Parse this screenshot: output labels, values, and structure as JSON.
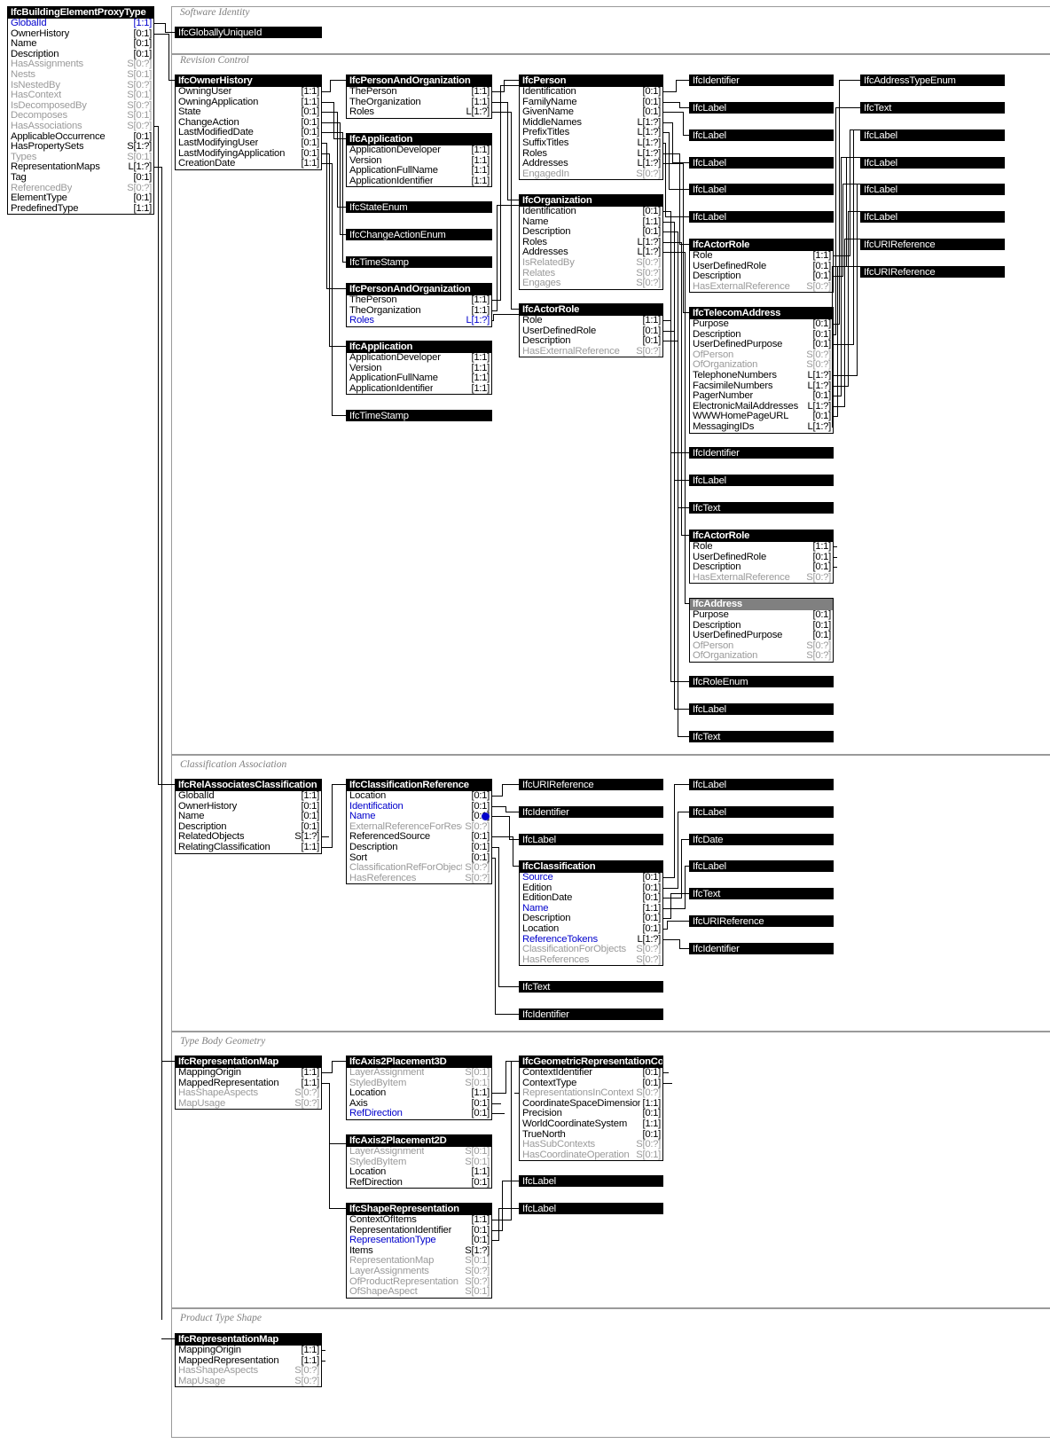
{
  "diagram": {
    "title": "IfcBuildingElementProxyType",
    "kind": "ifc-express-schema-diagram",
    "colors": {
      "entity_header_bg": "#000000",
      "abstract_header_bg": "#808080",
      "inverse_attr": "#9a9a9a",
      "key_attr": "#0000cc",
      "section_border": "#9a9a9a"
    }
  },
  "sections": [
    {
      "id": "software-identity",
      "label": "Software Identity"
    },
    {
      "id": "revision-control",
      "label": "Revision Control"
    },
    {
      "id": "classification-association",
      "label": "Classification Association"
    },
    {
      "id": "type-body-geometry",
      "label": "Type Body Geometry"
    },
    {
      "id": "product-type-shape",
      "label": "Product Type Shape"
    }
  ],
  "entities": {
    "root": {
      "name": "IfcBuildingElementProxyType",
      "attrs": [
        {
          "attr": "GlobalId",
          "card": "[1:1]",
          "style": "key"
        },
        {
          "attr": "OwnerHistory",
          "card": "[0:1]",
          "style": ""
        },
        {
          "attr": "Name",
          "card": "[0:1]",
          "style": ""
        },
        {
          "attr": "Description",
          "card": "[0:1]",
          "style": ""
        },
        {
          "attr": "HasAssignments",
          "card": "S[0:?]",
          "style": "inv"
        },
        {
          "attr": "Nests",
          "card": "S[0:1]",
          "style": "inv"
        },
        {
          "attr": "IsNestedBy",
          "card": "S[0:?]",
          "style": "inv"
        },
        {
          "attr": "HasContext",
          "card": "S[0:1]",
          "style": "inv"
        },
        {
          "attr": "IsDecomposedBy",
          "card": "S[0:?]",
          "style": "inv"
        },
        {
          "attr": "Decomposes",
          "card": "S[0:1]",
          "style": "inv"
        },
        {
          "attr": "HasAssociations",
          "card": "S[0:?]",
          "style": "inv"
        },
        {
          "attr": "ApplicableOccurrence",
          "card": "[0:1]",
          "style": ""
        },
        {
          "attr": "HasPropertySets",
          "card": "S[1:?]",
          "style": ""
        },
        {
          "attr": "Types",
          "card": "S[0:1]",
          "style": "inv"
        },
        {
          "attr": "RepresentationMaps",
          "card": "L[1:?]",
          "style": ""
        },
        {
          "attr": "Tag",
          "card": "[0:1]",
          "style": ""
        },
        {
          "attr": "ReferencedBy",
          "card": "S[0:?]",
          "style": "inv"
        },
        {
          "attr": "ElementType",
          "card": "[0:1]",
          "style": ""
        },
        {
          "attr": "PredefinedType",
          "card": "[1:1]",
          "style": ""
        }
      ]
    },
    "owner_history": {
      "name": "IfcOwnerHistory",
      "attrs": [
        {
          "attr": "OwningUser",
          "card": "[1:1]",
          "style": ""
        },
        {
          "attr": "OwningApplication",
          "card": "[1:1]",
          "style": ""
        },
        {
          "attr": "State",
          "card": "[0:1]",
          "style": ""
        },
        {
          "attr": "ChangeAction",
          "card": "[0:1]",
          "style": ""
        },
        {
          "attr": "LastModifiedDate",
          "card": "[0:1]",
          "style": ""
        },
        {
          "attr": "LastModifyingUser",
          "card": "[0:1]",
          "style": ""
        },
        {
          "attr": "LastModifyingApplication",
          "card": "[0:1]",
          "style": ""
        },
        {
          "attr": "CreationDate",
          "card": "[1:1]",
          "style": ""
        }
      ]
    },
    "person_and_org_1": {
      "name": "IfcPersonAndOrganization",
      "attrs": [
        {
          "attr": "ThePerson",
          "card": "[1:1]",
          "style": ""
        },
        {
          "attr": "TheOrganization",
          "card": "[1:1]",
          "style": ""
        },
        {
          "attr": "Roles",
          "card": "L[1:?]",
          "style": ""
        }
      ]
    },
    "application_1": {
      "name": "IfcApplication",
      "attrs": [
        {
          "attr": "ApplicationDeveloper",
          "card": "[1:1]",
          "style": ""
        },
        {
          "attr": "Version",
          "card": "[1:1]",
          "style": ""
        },
        {
          "attr": "ApplicationFullName",
          "card": "[1:1]",
          "style": ""
        },
        {
          "attr": "ApplicationIdentifier",
          "card": "[1:1]",
          "style": ""
        }
      ]
    },
    "person_and_org_2": {
      "name": "IfcPersonAndOrganization",
      "attrs": [
        {
          "attr": "ThePerson",
          "card": "[1:1]",
          "style": ""
        },
        {
          "attr": "TheOrganization",
          "card": "[1:1]",
          "style": ""
        },
        {
          "attr": "Roles",
          "card": "L[1:?]",
          "style": "key"
        }
      ]
    },
    "application_2": {
      "name": "IfcApplication",
      "attrs": [
        {
          "attr": "ApplicationDeveloper",
          "card": "[1:1]",
          "style": ""
        },
        {
          "attr": "Version",
          "card": "[1:1]",
          "style": ""
        },
        {
          "attr": "ApplicationFullName",
          "card": "[1:1]",
          "style": ""
        },
        {
          "attr": "ApplicationIdentifier",
          "card": "[1:1]",
          "style": ""
        }
      ]
    },
    "person": {
      "name": "IfcPerson",
      "attrs": [
        {
          "attr": "Identification",
          "card": "[0:1]",
          "style": ""
        },
        {
          "attr": "FamilyName",
          "card": "[0:1]",
          "style": ""
        },
        {
          "attr": "GivenName",
          "card": "[0:1]",
          "style": ""
        },
        {
          "attr": "MiddleNames",
          "card": "L[1:?]",
          "style": ""
        },
        {
          "attr": "PrefixTitles",
          "card": "L[1:?]",
          "style": ""
        },
        {
          "attr": "SuffixTitles",
          "card": "L[1:?]",
          "style": ""
        },
        {
          "attr": "Roles",
          "card": "L[1:?]",
          "style": ""
        },
        {
          "attr": "Addresses",
          "card": "L[1:?]",
          "style": ""
        },
        {
          "attr": "EngagedIn",
          "card": "S[0:?]",
          "style": "inv"
        }
      ]
    },
    "organization": {
      "name": "IfcOrganization",
      "attrs": [
        {
          "attr": "Identification",
          "card": "[0:1]",
          "style": ""
        },
        {
          "attr": "Name",
          "card": "[1:1]",
          "style": ""
        },
        {
          "attr": "Description",
          "card": "[0:1]",
          "style": ""
        },
        {
          "attr": "Roles",
          "card": "L[1:?]",
          "style": ""
        },
        {
          "attr": "Addresses",
          "card": "L[1:?]",
          "style": ""
        },
        {
          "attr": "IsRelatedBy",
          "card": "S[0:?]",
          "style": "inv"
        },
        {
          "attr": "Relates",
          "card": "S[0:?]",
          "style": "inv"
        },
        {
          "attr": "Engages",
          "card": "S[0:?]",
          "style": "inv"
        }
      ]
    },
    "actor_role_mid": {
      "name": "IfcActorRole",
      "attrs": [
        {
          "attr": "Role",
          "card": "[1:1]",
          "style": ""
        },
        {
          "attr": "UserDefinedRole",
          "card": "[0:1]",
          "style": ""
        },
        {
          "attr": "Description",
          "card": "[0:1]",
          "style": ""
        },
        {
          "attr": "HasExternalReference",
          "card": "S[0:?]",
          "style": "inv"
        }
      ]
    },
    "actor_role_r1": {
      "name": "IfcActorRole",
      "attrs": [
        {
          "attr": "Role",
          "card": "[1:1]",
          "style": ""
        },
        {
          "attr": "UserDefinedRole",
          "card": "[0:1]",
          "style": ""
        },
        {
          "attr": "Description",
          "card": "[0:1]",
          "style": ""
        },
        {
          "attr": "HasExternalReference",
          "card": "S[0:?]",
          "style": "inv"
        }
      ]
    },
    "actor_role_r2": {
      "name": "IfcActorRole",
      "attrs": [
        {
          "attr": "Role",
          "card": "[1:1]",
          "style": ""
        },
        {
          "attr": "UserDefinedRole",
          "card": "[0:1]",
          "style": ""
        },
        {
          "attr": "Description",
          "card": "[0:1]",
          "style": ""
        },
        {
          "attr": "HasExternalReference",
          "card": "S[0:?]",
          "style": "inv"
        }
      ]
    },
    "telecom_address": {
      "name": "IfcTelecomAddress",
      "attrs": [
        {
          "attr": "Purpose",
          "card": "[0:1]",
          "style": ""
        },
        {
          "attr": "Description",
          "card": "[0:1]",
          "style": ""
        },
        {
          "attr": "UserDefinedPurpose",
          "card": "[0:1]",
          "style": ""
        },
        {
          "attr": "OfPerson",
          "card": "S[0:?]",
          "style": "inv"
        },
        {
          "attr": "OfOrganization",
          "card": "S[0:?]",
          "style": "inv"
        },
        {
          "attr": "TelephoneNumbers",
          "card": "L[1:?]",
          "style": ""
        },
        {
          "attr": "FacsimileNumbers",
          "card": "L[1:?]",
          "style": ""
        },
        {
          "attr": "PagerNumber",
          "card": "[0:1]",
          "style": ""
        },
        {
          "attr": "ElectronicMailAddresses",
          "card": "L[1:?]",
          "style": ""
        },
        {
          "attr": "WWWHomePageURL",
          "card": "[0:1]",
          "style": ""
        },
        {
          "attr": "MessagingIDs",
          "card": "L[1:?]",
          "style": ""
        }
      ]
    },
    "address": {
      "name": "IfcAddress",
      "abstract": true,
      "attrs": [
        {
          "attr": "Purpose",
          "card": "[0:1]",
          "style": ""
        },
        {
          "attr": "Description",
          "card": "[0:1]",
          "style": ""
        },
        {
          "attr": "UserDefinedPurpose",
          "card": "[0:1]",
          "style": ""
        },
        {
          "attr": "OfPerson",
          "card": "S[0:?]",
          "style": "inv"
        },
        {
          "attr": "OfOrganization",
          "card": "S[0:?]",
          "style": "inv"
        }
      ]
    },
    "rel_associates_classification": {
      "name": "IfcRelAssociatesClassification",
      "attrs": [
        {
          "attr": "GlobalId",
          "card": "[1:1]",
          "style": ""
        },
        {
          "attr": "OwnerHistory",
          "card": "[0:1]",
          "style": ""
        },
        {
          "attr": "Name",
          "card": "[0:1]",
          "style": ""
        },
        {
          "attr": "Description",
          "card": "[0:1]",
          "style": ""
        },
        {
          "attr": "RelatedObjects",
          "card": "S[1:?]",
          "style": ""
        },
        {
          "attr": "RelatingClassification",
          "card": "[1:1]",
          "style": ""
        }
      ]
    },
    "classification_reference": {
      "name": "IfcClassificationReference",
      "attrs": [
        {
          "attr": "Location",
          "card": "[0:1]",
          "style": ""
        },
        {
          "attr": "Identification",
          "card": "[0:1]",
          "style": "keyname"
        },
        {
          "attr": "Name",
          "card": "[0:1]",
          "style": "keyname",
          "dot": true
        },
        {
          "attr": "ExternalReferenceForResources",
          "card": "S[0:?]",
          "style": "inv"
        },
        {
          "attr": "ReferencedSource",
          "card": "[0:1]",
          "style": ""
        },
        {
          "attr": "Description",
          "card": "[0:1]",
          "style": ""
        },
        {
          "attr": "Sort",
          "card": "[0:1]",
          "style": ""
        },
        {
          "attr": "ClassificationRefForObjects",
          "card": "S[0:?]",
          "style": "inv"
        },
        {
          "attr": "HasReferences",
          "card": "S[0:?]",
          "style": "inv"
        }
      ]
    },
    "classification": {
      "name": "IfcClassification",
      "attrs": [
        {
          "attr": "Source",
          "card": "[0:1]",
          "style": "keyname"
        },
        {
          "attr": "Edition",
          "card": "[0:1]",
          "style": ""
        },
        {
          "attr": "EditionDate",
          "card": "[0:1]",
          "style": ""
        },
        {
          "attr": "Name",
          "card": "[1:1]",
          "style": "keyname"
        },
        {
          "attr": "Description",
          "card": "[0:1]",
          "style": ""
        },
        {
          "attr": "Location",
          "card": "[0:1]",
          "style": ""
        },
        {
          "attr": "ReferenceTokens",
          "card": "L[1:?]",
          "style": "keyname"
        },
        {
          "attr": "ClassificationForObjects",
          "card": "S[0:?]",
          "style": "inv"
        },
        {
          "attr": "HasReferences",
          "card": "S[0:?]",
          "style": "inv"
        }
      ]
    },
    "representation_map_body": {
      "name": "IfcRepresentationMap",
      "attrs": [
        {
          "attr": "MappingOrigin",
          "card": "[1:1]",
          "style": ""
        },
        {
          "attr": "MappedRepresentation",
          "card": "[1:1]",
          "style": ""
        },
        {
          "attr": "HasShapeAspects",
          "card": "S[0:?]",
          "style": "inv"
        },
        {
          "attr": "MapUsage",
          "card": "S[0:?]",
          "style": "inv"
        }
      ]
    },
    "axis2placement3d": {
      "name": "IfcAxis2Placement3D",
      "attrs": [
        {
          "attr": "LayerAssignment",
          "card": "S[0:1]",
          "style": "inv"
        },
        {
          "attr": "StyledByItem",
          "card": "S[0:1]",
          "style": "inv"
        },
        {
          "attr": "Location",
          "card": "[1:1]",
          "style": ""
        },
        {
          "attr": "Axis",
          "card": "[0:1]",
          "style": ""
        },
        {
          "attr": "RefDirection",
          "card": "[0:1]",
          "style": "keyname"
        }
      ]
    },
    "axis2placement2d": {
      "name": "IfcAxis2Placement2D",
      "attrs": [
        {
          "attr": "LayerAssignment",
          "card": "S[0:1]",
          "style": "inv"
        },
        {
          "attr": "StyledByItem",
          "card": "S[0:1]",
          "style": "inv"
        },
        {
          "attr": "Location",
          "card": "[1:1]",
          "style": ""
        },
        {
          "attr": "RefDirection",
          "card": "[0:1]",
          "style": ""
        }
      ]
    },
    "shape_representation": {
      "name": "IfcShapeRepresentation",
      "attrs": [
        {
          "attr": "ContextOfItems",
          "card": "[1:1]",
          "style": ""
        },
        {
          "attr": "RepresentationIdentifier",
          "card": "[0:1]",
          "style": ""
        },
        {
          "attr": "RepresentationType",
          "card": "[0:1]",
          "style": "keyname"
        },
        {
          "attr": "Items",
          "card": "S[1:?]",
          "style": ""
        },
        {
          "attr": "RepresentationMap",
          "card": "S[0:1]",
          "style": "inv"
        },
        {
          "attr": "LayerAssignments",
          "card": "S[0:?]",
          "style": "inv"
        },
        {
          "attr": "OfProductRepresentation",
          "card": "S[0:?]",
          "style": "inv"
        },
        {
          "attr": "OfShapeAspect",
          "card": "S[0:1]",
          "style": "inv"
        }
      ]
    },
    "geometric_representation_context": {
      "name": "IfcGeometricRepresentationContext",
      "attrs": [
        {
          "attr": "ContextIdentifier",
          "card": "[0:1]",
          "style": ""
        },
        {
          "attr": "ContextType",
          "card": "[0:1]",
          "style": ""
        },
        {
          "attr": "RepresentationsInContext",
          "card": "S[0:?]",
          "style": "inv"
        },
        {
          "attr": "CoordinateSpaceDimension",
          "card": "[1:1]",
          "style": ""
        },
        {
          "attr": "Precision",
          "card": "[0:1]",
          "style": ""
        },
        {
          "attr": "WorldCoordinateSystem",
          "card": "[1:1]",
          "style": ""
        },
        {
          "attr": "TrueNorth",
          "card": "[0:1]",
          "style": ""
        },
        {
          "attr": "HasSubContexts",
          "card": "S[0:?]",
          "style": "inv"
        },
        {
          "attr": "HasCoordinateOperation",
          "card": "S[0:1]",
          "style": "inv"
        }
      ]
    },
    "representation_map_shape": {
      "name": "IfcRepresentationMap",
      "attrs": [
        {
          "attr": "MappingOrigin",
          "card": "[1:1]",
          "style": ""
        },
        {
          "attr": "MappedRepresentation",
          "card": "[1:1]",
          "style": ""
        },
        {
          "attr": "HasShapeAspects",
          "card": "S[0:?]",
          "style": "inv"
        },
        {
          "attr": "MapUsage",
          "card": "S[0:?]",
          "style": "inv"
        }
      ]
    }
  },
  "simple_types": {
    "globally_unique_id": "IfcGloballyUniqueId",
    "state_enum": "IfcStateEnum",
    "change_action_enum": "IfcChangeActionEnum",
    "timestamp_1": "IfcTimeStamp",
    "timestamp_2": "IfcTimeStamp",
    "col4_identifier_1": "IfcIdentifier",
    "col4_label_1": "IfcLabel",
    "col4_label_2": "IfcLabel",
    "col4_label_3": "IfcLabel",
    "col4_label_4": "IfcLabel",
    "col4_label_5": "IfcLabel",
    "col4_identifier_2": "IfcIdentifier",
    "col4_label_6": "IfcLabel",
    "col4_text_1": "IfcText",
    "col4_role_enum": "IfcRoleEnum",
    "col4_label_7": "IfcLabel",
    "col4_text_2": "IfcText",
    "col5_address_type_enum": "IfcAddressTypeEnum",
    "col5_text_1": "IfcText",
    "col5_label_1": "IfcLabel",
    "col5_label_2": "IfcLabel",
    "col5_label_3": "IfcLabel",
    "col5_label_4": "IfcLabel",
    "col5_uri_1": "IfcURIReference",
    "col5_uri_2": "IfcURIReference",
    "cls_uri_1": "IfcURIReference",
    "cls_identifier_1": "IfcIdentifier",
    "cls_label_1": "IfcLabel",
    "cls_text_1": "IfcText",
    "cls_identifier_2": "IfcIdentifier",
    "cls_label_r1": "IfcLabel",
    "cls_label_r2": "IfcLabel",
    "cls_date_r1": "IfcDate",
    "cls_label_r3": "IfcLabel",
    "cls_text_r1": "IfcText",
    "cls_uri_r1": "IfcURIReference",
    "cls_identifier_r1": "IfcIdentifier",
    "geo_label_1": "IfcLabel",
    "geo_label_2": "IfcLabel"
  }
}
